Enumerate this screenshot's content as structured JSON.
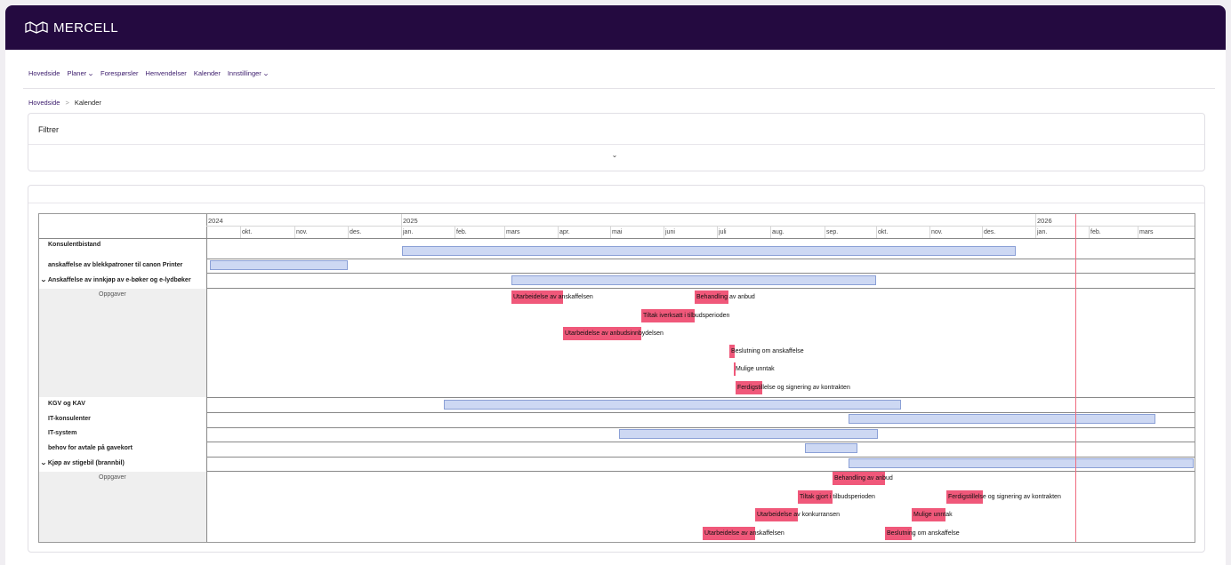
{
  "app": {
    "brand": "MERCELL"
  },
  "nav": [
    {
      "label": "Hovedside",
      "chevron": false
    },
    {
      "label": "Planer",
      "chevron": true
    },
    {
      "label": "Forespørsler",
      "chevron": false
    },
    {
      "label": "Henvendelser",
      "chevron": false
    },
    {
      "label": "Kalender",
      "chevron": false
    },
    {
      "label": "Innstillinger",
      "chevron": true
    }
  ],
  "breadcrumb": {
    "home": "Hovedside",
    "separator": ">",
    "current": "Kalender"
  },
  "filter": {
    "title": "Filtrer",
    "toggle_icon": "chevron-down-icon"
  },
  "timeline": {
    "years": [
      "2024",
      "2025",
      "2026"
    ],
    "months": [
      "okt.",
      "nov.",
      "des.",
      "jan.",
      "feb.",
      "mars",
      "apr.",
      "mai",
      "juni",
      "juli",
      "aug.",
      "sep.",
      "okt.",
      "nov.",
      "des.",
      "jan.",
      "feb.",
      "mars"
    ],
    "today_color": "#f06b80"
  },
  "rows": [
    {
      "label": "Konsulentbistand"
    },
    {
      "label": "anskaffelse av blekkpatroner til canon Printer"
    },
    {
      "label": "Anskaffelse av innkjøp av e-bøker og e-lydbøker",
      "expanded": true
    },
    {
      "label": "Oppgaver"
    },
    {
      "label": "KGV og KAV"
    },
    {
      "label": "IT-konsulenter"
    },
    {
      "label": "IT-system"
    },
    {
      "label": "behov for avtale på gavekort"
    },
    {
      "label": "Kjøp av stigebil (brannbil)",
      "expanded": true
    },
    {
      "label": "Oppgaver"
    }
  ],
  "tasks_ebok": [
    "Utarbeidelse av anskaffelsen",
    "Behandling av anbud",
    "Tiltak iverksatt i tilbudsperioden",
    "Utarbeidelse av anbudsinnbydelsen",
    "Beslutning om anskaffelse",
    "Mulige unntak",
    "Ferdigstillelse og signering av kontrakten"
  ],
  "tasks_stigebil": [
    "Behandling av anbud",
    "Tiltak gjort i tilbudsperioden",
    "Ferdigstillelse og signering av kontrakten",
    "Utarbeidelse av konkurransen",
    "Mulige unntak",
    "Utarbeidelse av anskaffelsen",
    "Beslutning om anskaffelse"
  ],
  "colors": {
    "topbar": "#240a40",
    "bar_fill": "#cdd8f3",
    "bar_border": "#8ba0d6",
    "task_fill": "#f0587a",
    "link": "#3a1a6b"
  }
}
